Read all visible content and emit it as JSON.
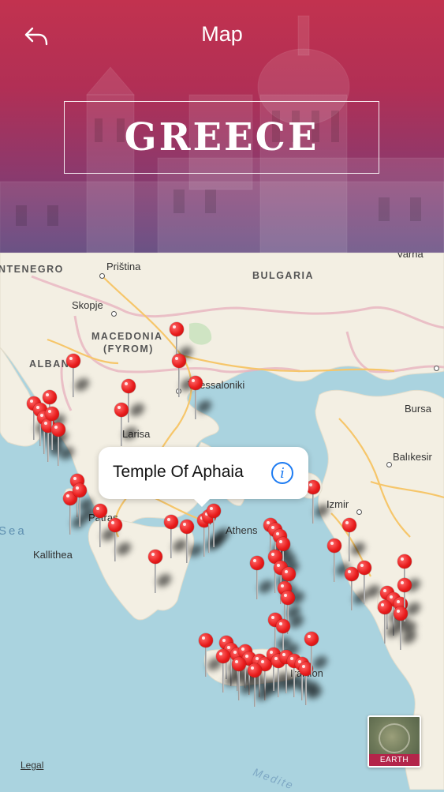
{
  "nav": {
    "title": "Map",
    "back_icon": "back-arrow-icon"
  },
  "header": {
    "banner_title": "GREECE"
  },
  "map": {
    "labels": {
      "montenegro": "NTENEGRO",
      "pristina": "Priština",
      "bulgaria": "BULGARIA",
      "varna": "Varna",
      "skopje": "Skopje",
      "macedonia": "MACEDONIA",
      "fyrom": "(FYROM)",
      "albania": "ALBAN",
      "thessaloniki": "Thessaloniki",
      "bursa": "Bursa",
      "larisa": "Larisa",
      "balikesir": "Balıkesir",
      "izmir": "Izmir",
      "sea": "Sea",
      "kallithea": "Kallithea",
      "patras": "Patras",
      "athens": "Athens",
      "iraklion": "Iraklion",
      "mediterranean": "Medite"
    },
    "callout": {
      "title": "Temple Of Aphaia",
      "info_icon": "info-icon"
    },
    "legal": "Legal",
    "earth_button": "EARTH",
    "colors": {
      "water": "#aad3df",
      "land": "#f3efe3",
      "pin": "#e81c1c",
      "header_top": "#c2324f",
      "header_bottom": "#5a3f78",
      "info_blue": "#1e7cf2"
    }
  }
}
